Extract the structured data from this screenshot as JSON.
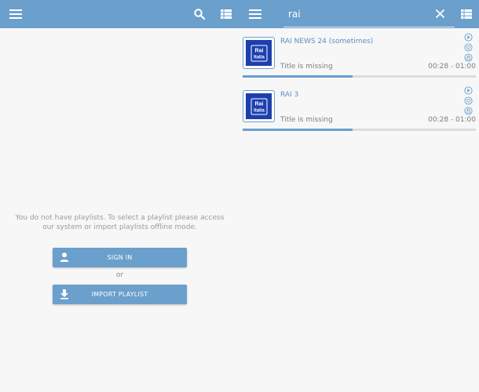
{
  "left": {
    "empty_message": "You do not have playlists. To select a playlist please access our system or import playlists offline mode.",
    "sign_in_label": "SIGN IN",
    "or_label": "or",
    "import_label": "IMPORT PLAYLIST"
  },
  "right": {
    "search_value": "rai",
    "results": [
      {
        "channel": "RAI NEWS 24 (sometimes)",
        "title": "Title is missing",
        "time": "00:28 - 01:00",
        "progress": 0.47,
        "logo_text_top": "Rai",
        "logo_text_bottom": "Italia"
      },
      {
        "channel": "RAI 3",
        "title": "Title is missing",
        "time": "00:28 - 01:00",
        "progress": 0.47,
        "logo_text_top": "Rai",
        "logo_text_bottom": "Italia"
      }
    ]
  },
  "colors": {
    "accent": "#6b9fcc",
    "background": "#f7f7f7",
    "logo_blue": "#1d3fae"
  },
  "icons": [
    "menu-icon",
    "search-icon",
    "view-list-icon",
    "close-icon",
    "person-icon",
    "download-icon",
    "play-icon",
    "heart-icon",
    "lock-icon"
  ]
}
